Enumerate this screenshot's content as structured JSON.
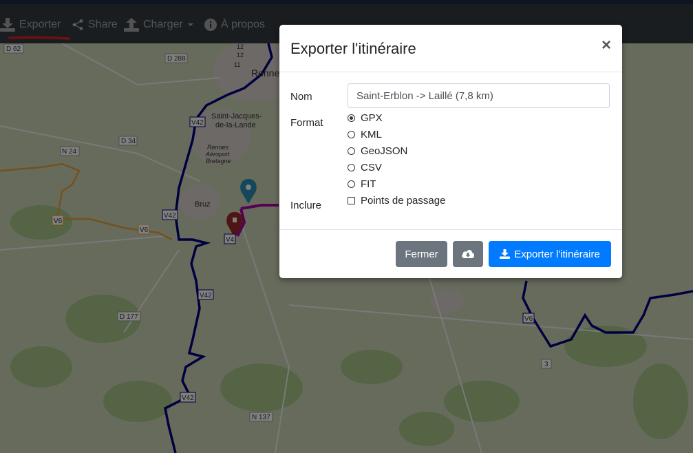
{
  "navbar": {
    "items": [
      {
        "label": "Exporter",
        "icon": "download-icon"
      },
      {
        "label": "Share",
        "icon": "share-icon"
      },
      {
        "label": "Charger",
        "icon": "upload-icon"
      },
      {
        "label": "À propos",
        "icon": "info-circle-icon"
      }
    ]
  },
  "map": {
    "places": [
      "D 62",
      "D 288",
      "Renne",
      "Saint-Jacques-",
      "de-la-Lande",
      "Rennes",
      "Aéroport",
      "Bretagne",
      "D 34",
      "N 24",
      "V42",
      "V42",
      "V42",
      "V42",
      "V6",
      "V6",
      "V6",
      "V4",
      "Bruz",
      "D 177",
      "N 137",
      "3",
      "12",
      "12",
      "11"
    ]
  },
  "modal": {
    "title": "Exporter l'itinéraire",
    "close_symbol": "×",
    "name_label": "Nom",
    "name_value": "Saint-Erblon -> Laillé (7,8 km)",
    "format_label": "Format",
    "formats": [
      "GPX",
      "KML",
      "GeoJSON",
      "CSV",
      "FIT"
    ],
    "selected_format": "GPX",
    "include_label": "Inclure",
    "include_options": [
      {
        "label": "Points de passage",
        "checked": false
      }
    ],
    "buttons": {
      "close_label": "Fermer",
      "cloud_icon": "cloud-download-icon",
      "export_label": "Exporter l'itinéraire"
    }
  },
  "colors": {
    "navbar_bg": "#343a40",
    "primary": "#007bff",
    "secondary": "#6c757d",
    "route": "#000080",
    "track": "#aa00aa",
    "highlight_underline": "#e02020"
  }
}
